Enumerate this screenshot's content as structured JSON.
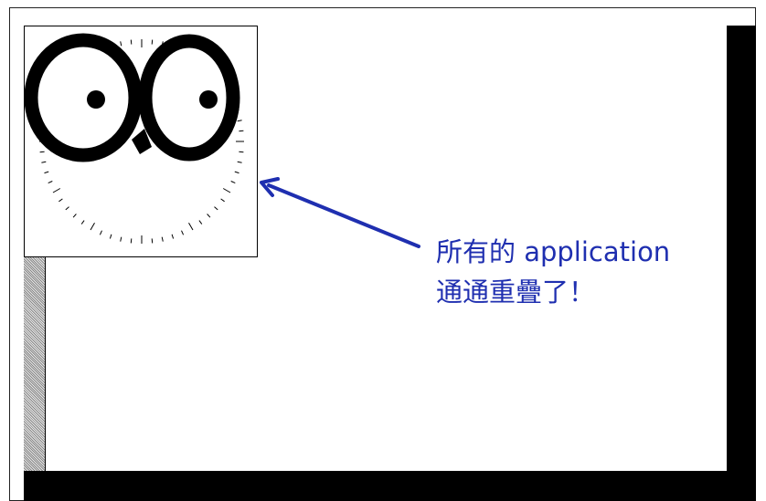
{
  "annotation": {
    "line1": "所有的 application",
    "line2": "通通重疊了！",
    "color": "#1f2fb0"
  },
  "desktop": {
    "window": "xeyes-window",
    "icons": [
      "eye-icon",
      "clock-icon"
    ]
  }
}
